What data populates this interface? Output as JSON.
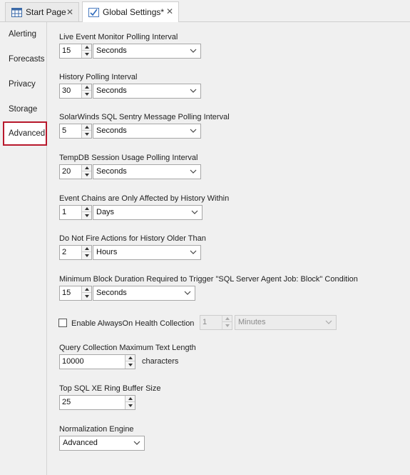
{
  "tabs": [
    {
      "label": "Start Page",
      "active": false
    },
    {
      "label": "Global Settings*",
      "active": true
    }
  ],
  "tab_close_glyph": "✕",
  "nav": {
    "items": [
      "Alerting",
      "Forecasts",
      "Privacy",
      "Storage",
      "Advanced"
    ],
    "selected": "Advanced",
    "selected_border_color": "#b8192c"
  },
  "settings": {
    "live_event": {
      "label": "Live Event Monitor Polling Interval",
      "value": "15",
      "unit": "Seconds"
    },
    "history": {
      "label": "History Polling Interval",
      "value": "30",
      "unit": "Seconds"
    },
    "solarwinds": {
      "label": "SolarWinds SQL Sentry Message Polling Interval",
      "value": "5",
      "unit": "Seconds"
    },
    "tempdb": {
      "label": "TempDB Session Usage Polling Interval",
      "value": "20",
      "unit": "Seconds"
    },
    "event_chains": {
      "label": "Event Chains are Only Affected by History Within",
      "value": "1",
      "unit": "Days"
    },
    "no_fire": {
      "label": "Do Not Fire Actions for History Older Than",
      "value": "2",
      "unit": "Hours"
    },
    "min_block": {
      "label": "Minimum Block Duration Required to Trigger \"SQL Server Agent Job: Block\" Condition",
      "value": "15",
      "unit": "Seconds"
    },
    "alwayson": {
      "label": "Enable AlwaysOn Health Collection",
      "checked": false,
      "value": "1",
      "unit": "Minutes"
    },
    "query_text": {
      "label": "Query Collection Maximum Text Length",
      "value": "10000",
      "suffix": "characters"
    },
    "ring_buffer": {
      "label": "Top SQL XE Ring Buffer Size",
      "value": "25"
    },
    "normalization": {
      "label": "Normalization Engine",
      "value": "Advanced"
    }
  },
  "icons": {
    "start_page": "grid-icon",
    "global_settings": "checklist-icon",
    "spin_up": "triangle-up-icon",
    "spin_down": "triangle-down-icon",
    "dropdown": "chevron-down-icon"
  }
}
